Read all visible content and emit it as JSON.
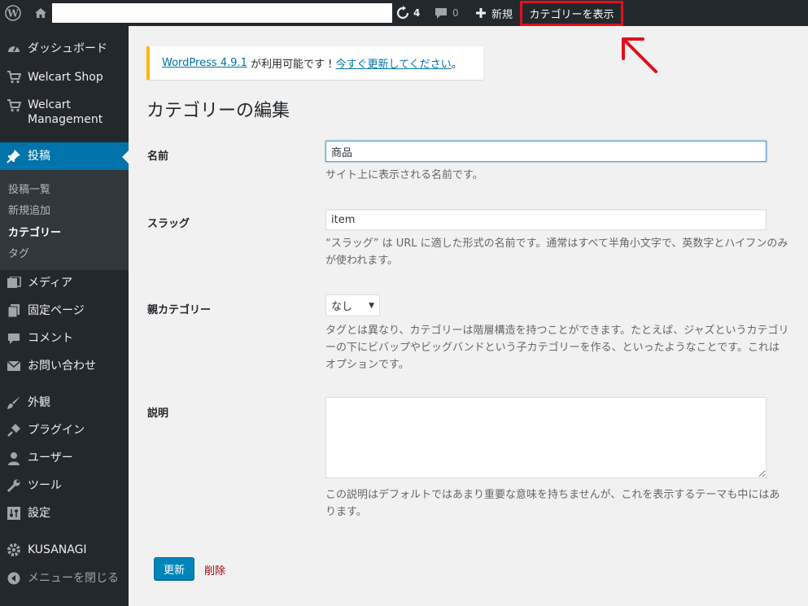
{
  "adminbar": {
    "updates_count": "4",
    "comments_count": "0",
    "new_label": "新規",
    "view_category_label": "カテゴリーを表示"
  },
  "sidebar": {
    "items": [
      {
        "label": "ダッシュボード",
        "icon": "dashboard-icon"
      },
      {
        "label": "Welcart Shop",
        "icon": "cart-icon"
      },
      {
        "label": "Welcart Management",
        "icon": "cart-icon"
      },
      {
        "label": "投稿",
        "icon": "pin-icon"
      },
      {
        "label": "メディア",
        "icon": "media-icon"
      },
      {
        "label": "固定ページ",
        "icon": "page-icon"
      },
      {
        "label": "コメント",
        "icon": "comment-icon"
      },
      {
        "label": "お問い合わせ",
        "icon": "mail-icon"
      },
      {
        "label": "外観",
        "icon": "brush-icon"
      },
      {
        "label": "プラグイン",
        "icon": "plugin-icon"
      },
      {
        "label": "ユーザー",
        "icon": "user-icon"
      },
      {
        "label": "ツール",
        "icon": "wrench-icon"
      },
      {
        "label": "設定",
        "icon": "settings-icon"
      },
      {
        "label": "KUSANAGI",
        "icon": "gear-icon"
      },
      {
        "label": "メニューを閉じる",
        "icon": "collapse-icon"
      }
    ],
    "submenu": [
      "投稿一覧",
      "新規追加",
      "カテゴリー",
      "タグ"
    ]
  },
  "notice": {
    "version_link": "WordPress 4.9.1",
    "middle_text": " が利用可能です ! ",
    "update_link": "今すぐ更新してください",
    "end_text": "。"
  },
  "page": {
    "title": "カテゴリーの編集"
  },
  "form": {
    "name_label": "名前",
    "name_value": "商品",
    "name_desc": "サイト上に表示される名前です。",
    "slug_label": "スラッグ",
    "slug_value": "item",
    "slug_desc": "“スラッグ” は URL に適した形式の名前です。通常はすべて半角小文字で、英数字とハイフンのみが使われます。",
    "parent_label": "親カテゴリー",
    "parent_value": "なし",
    "parent_desc": "タグとは異なり、カテゴリーは階層構造を持つことができます。たとえば、ジャズというカテゴリーの下にビバップやビッグバンドという子カテゴリーを作る、といったようなことです。これはオプションです。",
    "description_label": "説明",
    "description_value": "",
    "description_desc": "この説明はデフォルトではあまり重要な意味を持ちませんが、これを表示するテーマも中にはあります。",
    "update_button": "更新",
    "delete_link": "削除"
  },
  "colors": {
    "accent": "#0073aa",
    "highlight_box": "#e0101c"
  }
}
